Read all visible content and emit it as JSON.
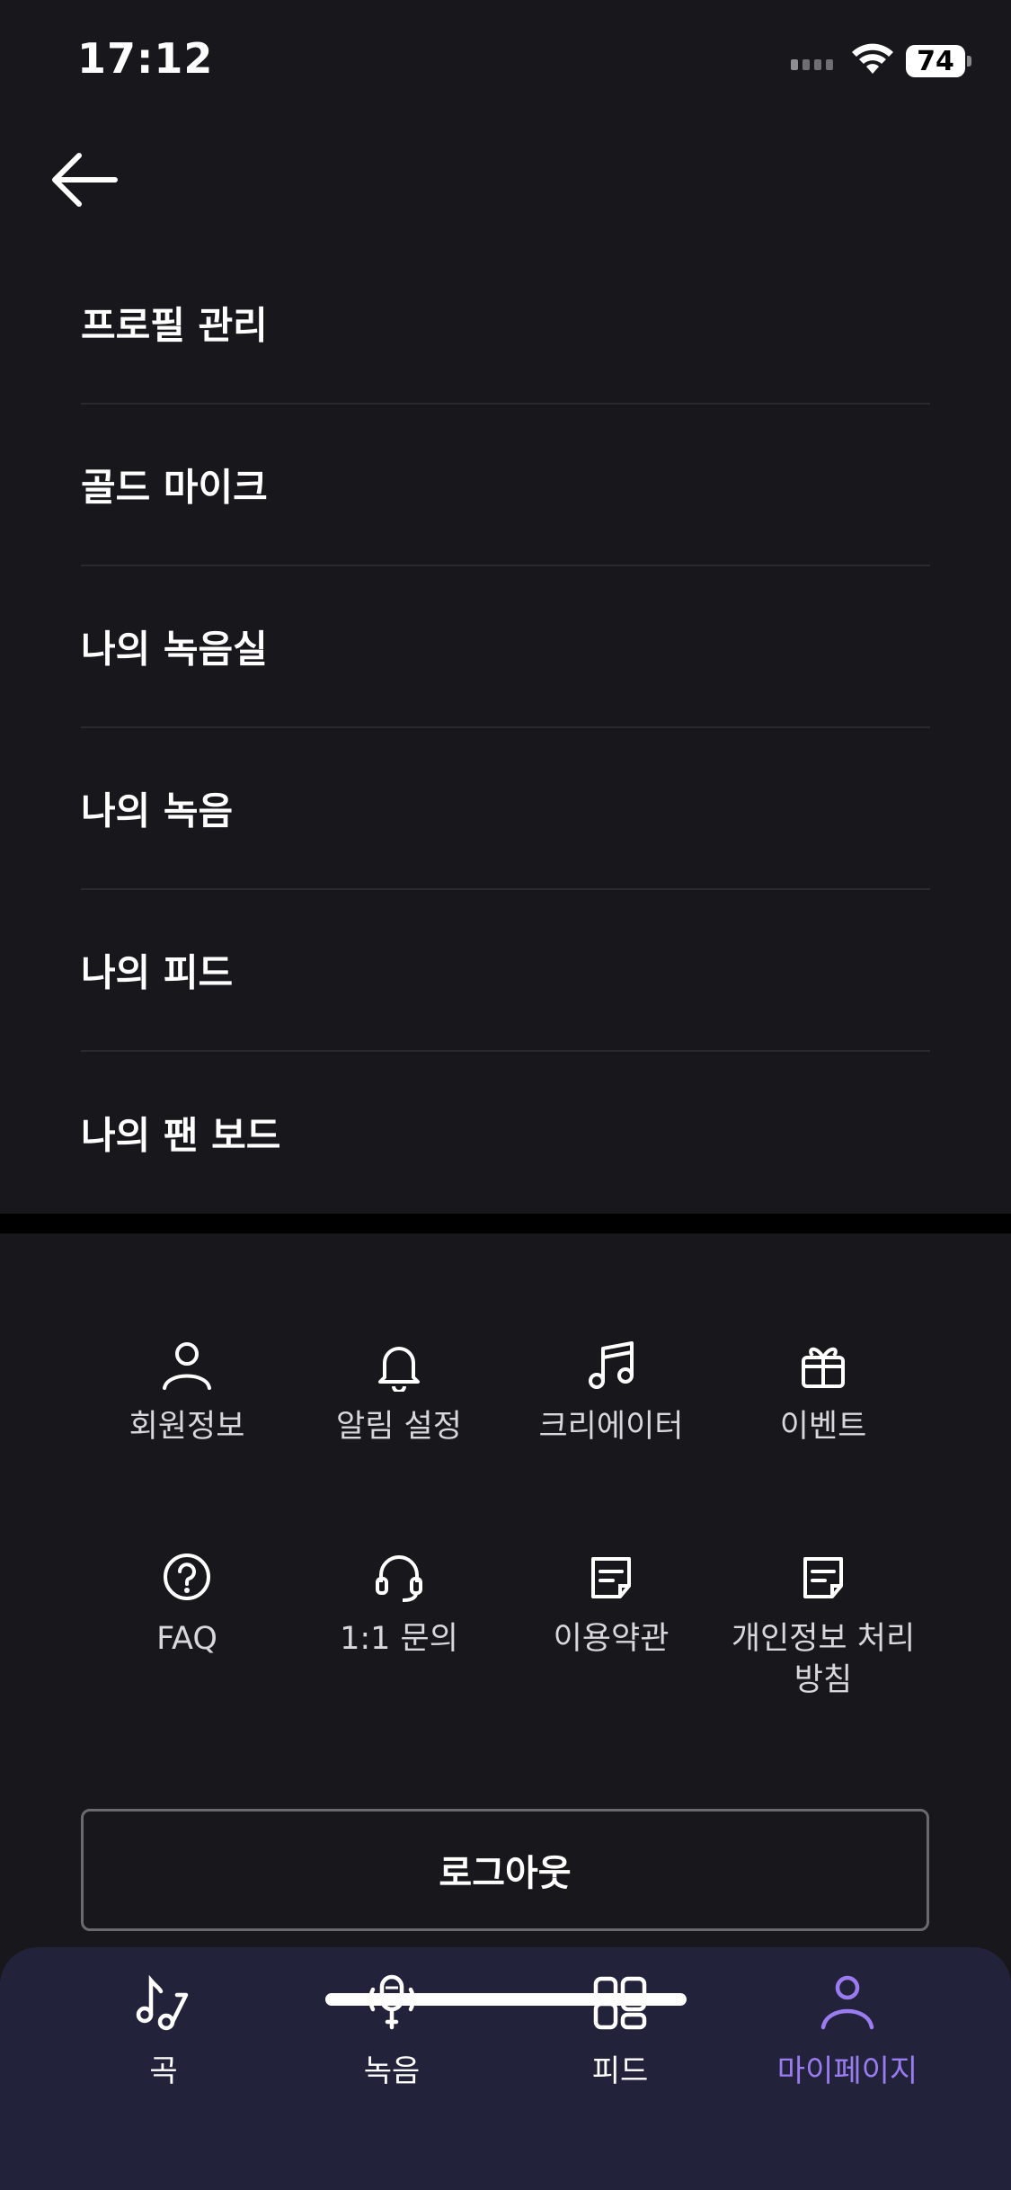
{
  "status_bar": {
    "time": "17:12",
    "battery": "74"
  },
  "menu": [
    {
      "label": "프로필 관리"
    },
    {
      "label": "골드 마이크"
    },
    {
      "label": "나의 녹음실"
    },
    {
      "label": "나의 녹음"
    },
    {
      "label": "나의 피드"
    },
    {
      "label": "나의 팬 보드"
    }
  ],
  "shortcuts": [
    {
      "label": "회원정보",
      "icon": "person-icon"
    },
    {
      "label": "알림 설정",
      "icon": "bell-icon"
    },
    {
      "label": "크리에이터",
      "icon": "music-note-icon"
    },
    {
      "label": "이벤트",
      "icon": "gift-icon"
    },
    {
      "label": "FAQ",
      "icon": "question-icon"
    },
    {
      "label": "1:1 문의",
      "icon": "headset-icon"
    },
    {
      "label": "이용약관",
      "icon": "document-icon"
    },
    {
      "label": "개인정보 처리방침",
      "icon": "document-icon"
    }
  ],
  "logout_label": "로그아웃",
  "bottom_nav": [
    {
      "label": "곡",
      "icon": "music-notes-icon",
      "active": false
    },
    {
      "label": "녹음",
      "icon": "microphone-icon",
      "active": false
    },
    {
      "label": "피드",
      "icon": "grid-icon",
      "active": false
    },
    {
      "label": "마이페이지",
      "icon": "person-icon",
      "active": true
    }
  ],
  "colors": {
    "background": "#18171c",
    "accent": "#9b7cf0",
    "nav_background": "#22233a"
  }
}
